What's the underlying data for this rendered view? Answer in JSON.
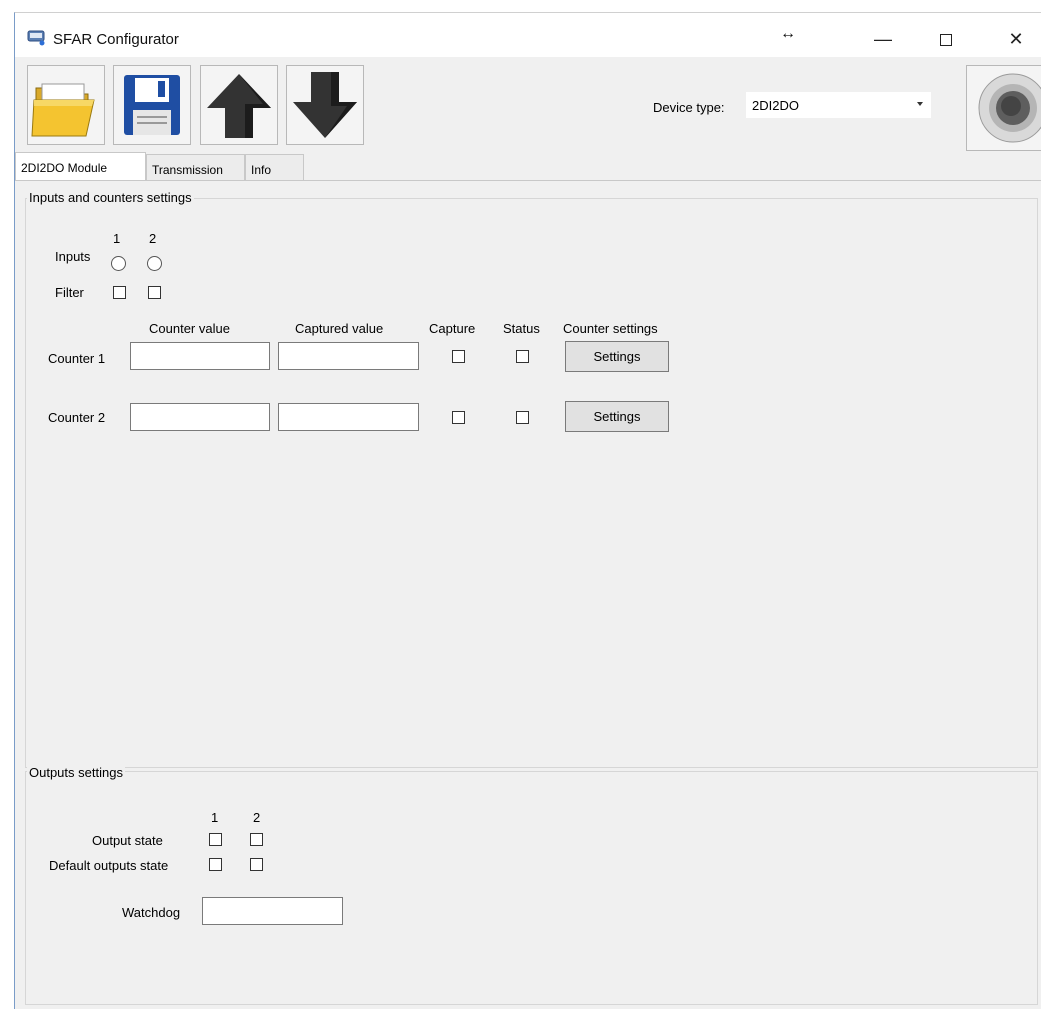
{
  "window": {
    "title": "SFAR Configurator",
    "resize_glyph": "↔",
    "minimize_glyph": "—",
    "close_glyph": "✕"
  },
  "toolbar": {
    "open_icon": "folder-open-icon",
    "save_icon": "floppy-save-icon",
    "upload_icon": "arrow-up-icon",
    "download_icon": "arrow-down-icon",
    "device_type_label": "Device type:",
    "device_type_value": "2DI2DO",
    "connect_icon": "connect-dial-icon"
  },
  "tabs": [
    {
      "label": "2DI2DO Module",
      "active": true
    },
    {
      "label": "Transmission",
      "active": false
    },
    {
      "label": "Info",
      "active": false
    }
  ],
  "inputs_group": {
    "title": "Inputs and counters settings",
    "inputs_label": "Inputs",
    "filter_label": "Filter",
    "channel_1": "1",
    "channel_2": "2",
    "columns": {
      "counter_value": "Counter value",
      "captured_value": "Captured value",
      "capture": "Capture",
      "status": "Status",
      "counter_settings": "Counter settings"
    },
    "counters": [
      {
        "label": "Counter 1",
        "counter_value": "",
        "captured_value": "",
        "settings_label": "Settings"
      },
      {
        "label": "Counter 2",
        "counter_value": "",
        "captured_value": "",
        "settings_label": "Settings"
      }
    ]
  },
  "outputs_group": {
    "title": "Outputs settings",
    "channel_1": "1",
    "channel_2": "2",
    "output_state_label": "Output state",
    "default_state_label": "Default outputs state",
    "watchdog_label": "Watchdog",
    "watchdog_value": ""
  },
  "colors": {
    "window_bg": "#f0f0f0",
    "title_bar_bg": "#ffffff",
    "folder_yellow": "#f4c430",
    "save_blue": "#1f4ea3",
    "arrow_dark": "#333333"
  }
}
